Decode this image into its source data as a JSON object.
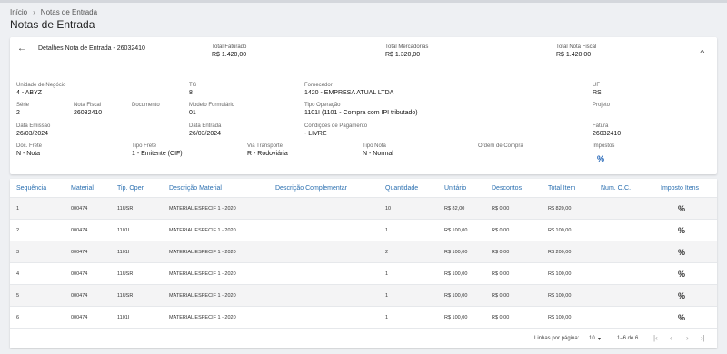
{
  "breadcrumb": {
    "home": "Início",
    "separator": "›",
    "current": "Notas de Entrada"
  },
  "page_title": "Notas de Entrada",
  "detail": {
    "title": "Detalhes Nota de Entrada - 26032410",
    "totals": [
      {
        "label": "Total Faturado",
        "value": "R$ 1.420,00"
      },
      {
        "label": "Total Mercadorias",
        "value": "R$ 1.320,00"
      },
      {
        "label": "Total Nota Fiscal",
        "value": "R$ 1.420,00"
      }
    ],
    "fields": {
      "unidade": {
        "label": "Unidade de Negócio",
        "value": "4 - ABYZ"
      },
      "tg": {
        "label": "TG",
        "value": "8"
      },
      "fornecedor": {
        "label": "Fornecedor",
        "value": "1420 - EMPRESA ATUAL LTDA"
      },
      "uf": {
        "label": "UF",
        "value": "RS"
      },
      "serie": {
        "label": "Série",
        "value": "2"
      },
      "nota_fiscal": {
        "label": "Nota Fiscal",
        "value": "26032410"
      },
      "documento": {
        "label": "Documento",
        "value": ""
      },
      "modelo": {
        "label": "Modelo Formulário",
        "value": "01"
      },
      "tipo_operacao": {
        "label": "Tipo Operação",
        "value": "1101I (1101 - Compra com IPI tributado)"
      },
      "projeto": {
        "label": "Projeto",
        "value": ""
      },
      "data_emissao": {
        "label": "Data Emissão",
        "value": "26/03/2024"
      },
      "data_entrada": {
        "label": "Data Entrada",
        "value": "26/03/2024"
      },
      "cond_pagamento": {
        "label": "Condições de Pagamento",
        "value": "- LIVRE"
      },
      "fatura": {
        "label": "Fatura",
        "value": "26032410"
      },
      "doc_frete": {
        "label": "Doc. Frete",
        "value": "N - Nota"
      },
      "tipo_frete": {
        "label": "Tipo Frete",
        "value": "1 - Emitente (CIF)"
      },
      "via_transporte": {
        "label": "Via Transporte",
        "value": "R - Rodoviária"
      },
      "tipo_nota": {
        "label": "Tipo Nota",
        "value": "N - Normal"
      },
      "ordem_compra": {
        "label": "Ordem de Compra",
        "value": ""
      },
      "impostos": {
        "label": "Impostos",
        "icon": "percent-icon"
      }
    }
  },
  "table": {
    "headers": [
      "Sequência",
      "Material",
      "Tip. Oper.",
      "Descrição Material",
      "Descrição Complementar",
      "Quantidade",
      "Unitário",
      "Descontos",
      "Total Item",
      "Num. O.C.",
      "Imposto Itens"
    ],
    "rows": [
      [
        "1",
        "000474",
        "11USR",
        "MATERIAL ESPECIF 1 - 2020",
        "",
        "10",
        "R$ 82,00",
        "R$ 0,00",
        "R$ 820,00",
        ""
      ],
      [
        "2",
        "000474",
        "1101I",
        "MATERIAL ESPECIF 1 - 2020",
        "",
        "1",
        "R$ 100,00",
        "R$ 0,00",
        "R$ 100,00",
        ""
      ],
      [
        "3",
        "000474",
        "1101I",
        "MATERIAL ESPECIF 1 - 2020",
        "",
        "2",
        "R$ 100,00",
        "R$ 0,00",
        "R$ 200,00",
        ""
      ],
      [
        "4",
        "000474",
        "11USR",
        "MATERIAL ESPECIF 1 - 2020",
        "",
        "1",
        "R$ 100,00",
        "R$ 0,00",
        "R$ 100,00",
        ""
      ],
      [
        "5",
        "000474",
        "11USR",
        "MATERIAL ESPECIF 1 - 2020",
        "",
        "1",
        "R$ 100,00",
        "R$ 0,00",
        "R$ 100,00",
        ""
      ],
      [
        "6",
        "000474",
        "1101I",
        "MATERIAL ESPECIF 1 - 2020",
        "",
        "1",
        "R$ 100,00",
        "R$ 0,00",
        "R$ 100,00",
        ""
      ]
    ],
    "percent_glyph": "%"
  },
  "pagination": {
    "rows_per_page_label": "Linhas por página:",
    "rows_per_page_value": "10",
    "range": "1–6 de 6"
  },
  "colors": {
    "accent": "#2a6fb0",
    "percent_icon": "#1a5fb4"
  }
}
